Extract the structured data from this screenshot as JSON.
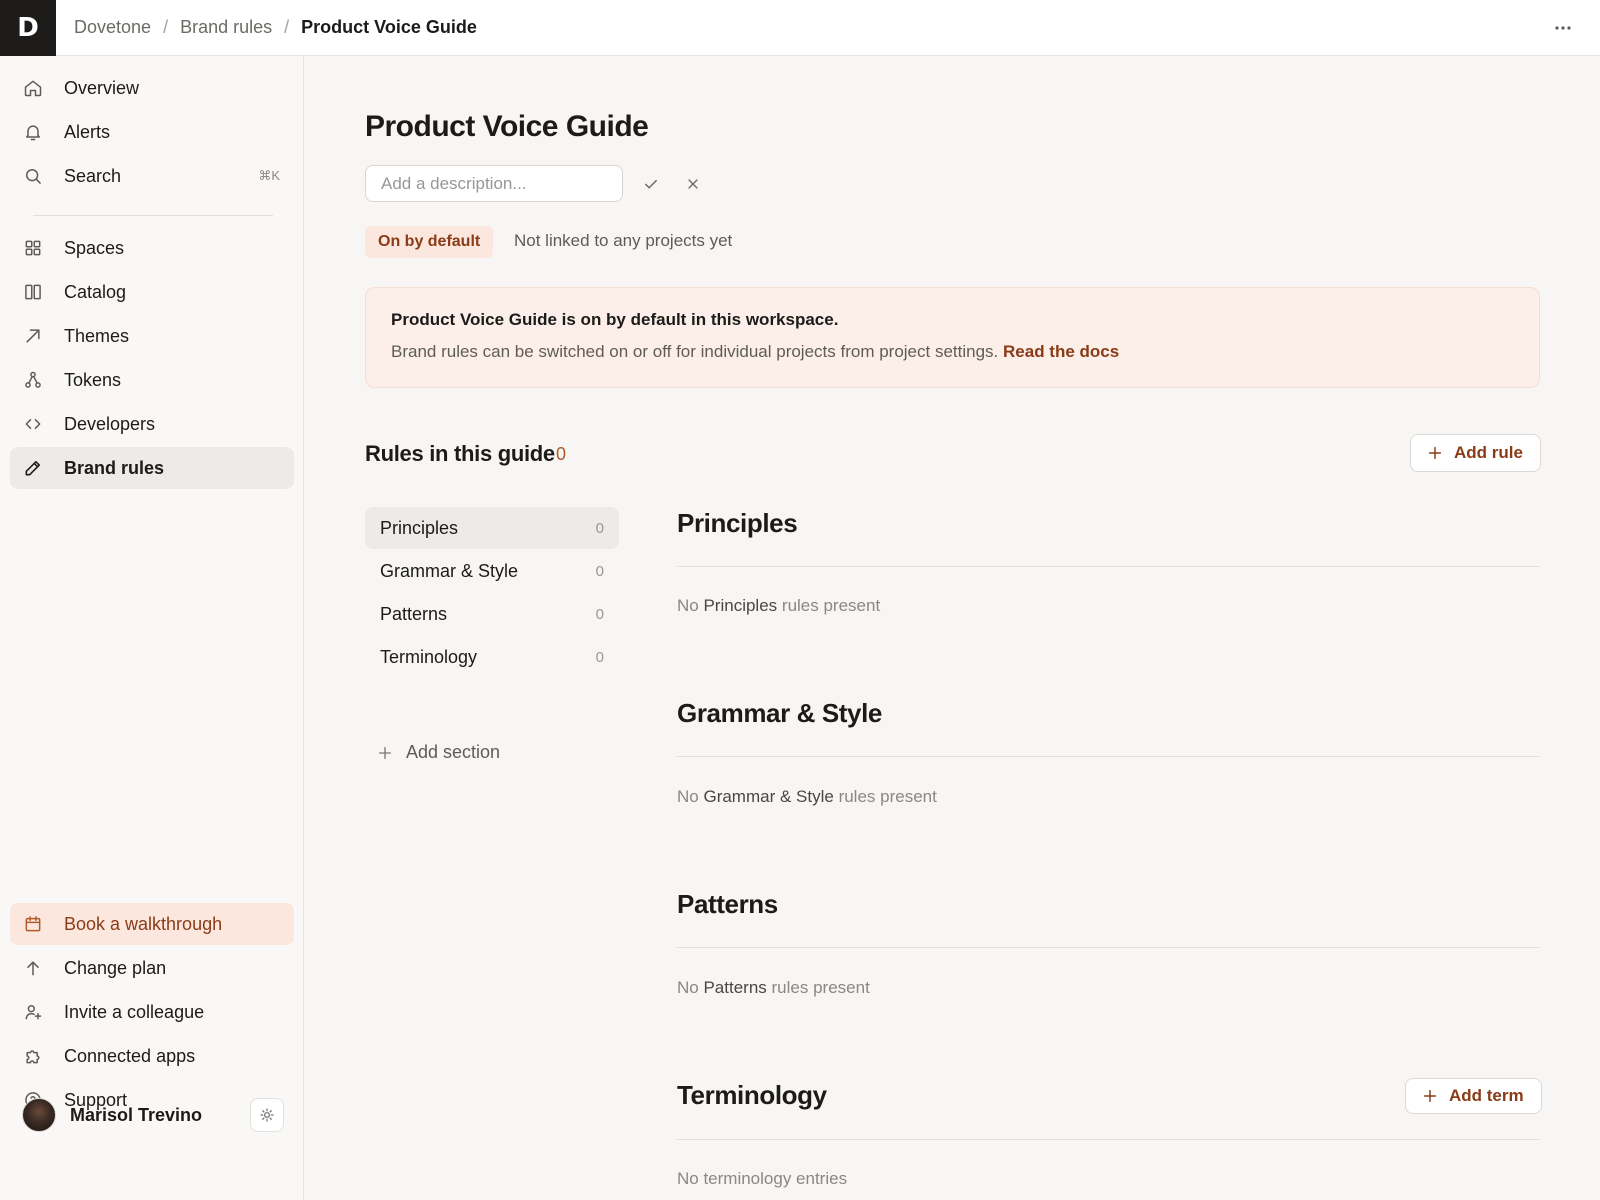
{
  "app": {
    "logo_letter": "D",
    "breadcrumb": [
      "Dovetone",
      "Brand rules",
      "Product Voice Guide"
    ],
    "breadcrumb_separator": "/"
  },
  "sidebar": {
    "primary": [
      {
        "label": "Overview",
        "icon": "home-icon"
      },
      {
        "label": "Alerts",
        "icon": "bell-icon"
      },
      {
        "label": "Search",
        "icon": "search-icon",
        "shortcut": "⌘K"
      }
    ],
    "secondary": [
      {
        "label": "Spaces",
        "icon": "grid-icon"
      },
      {
        "label": "Catalog",
        "icon": "columns-icon"
      },
      {
        "label": "Themes",
        "icon": "arrow-up-right-icon"
      },
      {
        "label": "Tokens",
        "icon": "nodes-icon"
      },
      {
        "label": "Developers",
        "icon": "code-icon"
      },
      {
        "label": "Brand rules",
        "icon": "pencil-icon",
        "active": true
      }
    ],
    "footer": [
      {
        "label": "Book a walkthrough",
        "icon": "calendar-icon",
        "highlight": true
      },
      {
        "label": "Change plan",
        "icon": "arrow-up-icon"
      },
      {
        "label": "Invite a colleague",
        "icon": "user-plus-icon"
      },
      {
        "label": "Connected apps",
        "icon": "puzzle-icon"
      },
      {
        "label": "Support",
        "icon": "help-circle-icon"
      }
    ],
    "user": {
      "name": "Marisol Trevino"
    }
  },
  "page": {
    "title": "Product Voice Guide",
    "description_placeholder": "Add a description...",
    "description_value": "",
    "badge": "On by default",
    "linked_status": "Not linked to any projects yet",
    "callout": {
      "title": "Product Voice Guide is on by default in this workspace.",
      "body": "Brand rules can be switched on or off for individual projects from project settings.",
      "link": "Read the docs"
    },
    "rules_heading": "Rules in this guide",
    "rules_count": "0",
    "add_rule_label": "Add rule",
    "section_nav": [
      {
        "label": "Principles",
        "count": "0",
        "active": true
      },
      {
        "label": "Grammar & Style",
        "count": "0"
      },
      {
        "label": "Patterns",
        "count": "0"
      },
      {
        "label": "Terminology",
        "count": "0"
      }
    ],
    "add_section_label": "Add section",
    "sections": [
      {
        "title": "Principles",
        "empty_prefix": "No",
        "empty_name": "Principles",
        "empty_suffix": "rules present"
      },
      {
        "title": "Grammar & Style",
        "empty_prefix": "No",
        "empty_name": "Grammar & Style",
        "empty_suffix": "rules present"
      },
      {
        "title": "Patterns",
        "empty_prefix": "No",
        "empty_name": "Patterns",
        "empty_suffix": "rules present"
      },
      {
        "title": "Terminology",
        "empty_text": "No terminology entries",
        "action_label": "Add term"
      }
    ]
  },
  "colors": {
    "accent": "#8a3b17",
    "accent_soft": "#fbe7dd",
    "callout_bg": "#fcefe9",
    "sidebar_active": "#ecebe8"
  }
}
